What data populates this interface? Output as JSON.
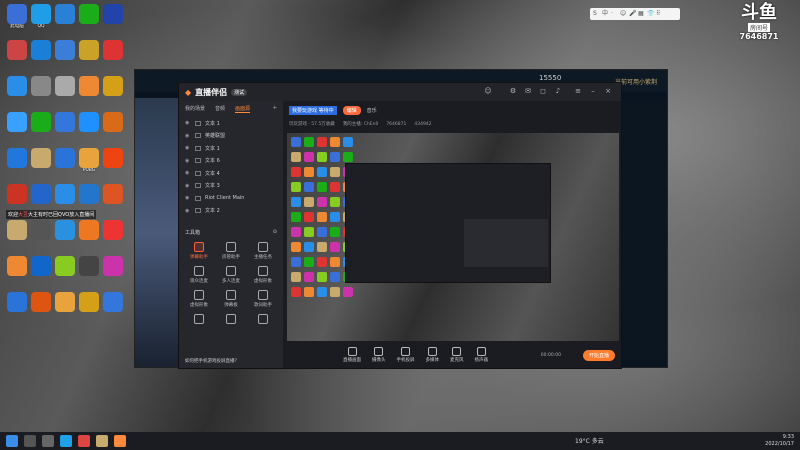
{
  "desktop": {
    "icons": [
      {
        "label": "此电脑",
        "color": "#3a6fd8"
      },
      {
        "label": "QQ",
        "color": "#1e9ee8"
      },
      {
        "label": "",
        "color": "#2a7fd6"
      },
      {
        "label": "",
        "color": "#1aad19"
      },
      {
        "label": "",
        "color": "#2244aa"
      },
      {
        "label": "",
        "color": "#c44"
      },
      {
        "label": "",
        "color": "#1a7fd6"
      },
      {
        "label": "",
        "color": "#3b7ed8"
      },
      {
        "label": "",
        "color": "#c9a227"
      },
      {
        "label": "",
        "color": "#d33"
      },
      {
        "label": "",
        "color": "#2a8de8"
      },
      {
        "label": "",
        "color": "#888"
      },
      {
        "label": "",
        "color": "#aaa"
      },
      {
        "label": "",
        "color": "#ee8833"
      },
      {
        "label": "",
        "color": "#d4a017"
      },
      {
        "label": "",
        "color": "#3aa0ff"
      },
      {
        "label": "",
        "color": "#1aad19"
      },
      {
        "label": "",
        "color": "#3377dd"
      },
      {
        "label": "",
        "color": "#1e90ff"
      },
      {
        "label": "",
        "color": "#d86a1a"
      },
      {
        "label": "",
        "color": "#2277dd"
      },
      {
        "label": "",
        "color": "#c8aa6e"
      },
      {
        "label": "",
        "color": "#2a73d8"
      },
      {
        "label": "PUBG",
        "color": "#e8a33d"
      },
      {
        "label": "",
        "color": "#ee4411"
      },
      {
        "label": "",
        "color": "#cc3322"
      },
      {
        "label": "",
        "color": "#2266cc"
      },
      {
        "label": "",
        "color": "#2a8de8"
      },
      {
        "label": "",
        "color": "#2277cc"
      },
      {
        "label": "",
        "color": "#dd5522"
      },
      {
        "label": "",
        "color": "#c8aa6e"
      },
      {
        "label": "",
        "color": "#555"
      },
      {
        "label": "",
        "color": "#2a90e0"
      },
      {
        "label": "",
        "color": "#ee7722"
      },
      {
        "label": "",
        "color": "#ee3333"
      },
      {
        "label": "",
        "color": "#ee8833"
      },
      {
        "label": "",
        "color": "#1166cc"
      },
      {
        "label": "",
        "color": "#88cc22"
      },
      {
        "label": "",
        "color": "#444"
      },
      {
        "label": "",
        "color": "#cc33aa"
      },
      {
        "label": "",
        "color": "#2a73d8"
      },
      {
        "label": "",
        "color": "#dd5511"
      },
      {
        "label": "",
        "color": "#e8a33d"
      },
      {
        "label": "",
        "color": "#d4a017"
      },
      {
        "label": "",
        "color": "#3377dd"
      }
    ],
    "notice": {
      "prefix": "欢迎",
      "highlight": "大豆",
      "suffix": "大主有时已回QVO放入直播间"
    }
  },
  "topbar_icons": [
    "S",
    "中",
    "·",
    "☺",
    "🎤",
    "▦",
    "👕",
    "⠿"
  ],
  "watermark": {
    "logo": "斗鱼",
    "room_label": "房间号",
    "room_id": "7646871"
  },
  "lol_client": {
    "coins": "15550",
    "shop_label": "当前可用小紫荆"
  },
  "app": {
    "brand": "直播伴侣",
    "version": "测试",
    "tabs": [
      {
        "label": "我的场景"
      },
      {
        "label": "音频"
      },
      {
        "label": "画面源",
        "active": true
      }
    ],
    "sources": [
      {
        "label": "文本 1"
      },
      {
        "label": "英雄联盟"
      },
      {
        "label": "文本 1"
      },
      {
        "label": "文本 6"
      },
      {
        "label": "文本 4"
      },
      {
        "label": "文本 3"
      },
      {
        "label": "Riot Client Main"
      },
      {
        "label": "文本 2"
      }
    ],
    "toolbox_label": "工具箱",
    "tools": [
      {
        "label": "弹幕助手",
        "hot": true
      },
      {
        "label": "房管助手"
      },
      {
        "label": "主播任务"
      },
      {
        "label": "观众连麦"
      },
      {
        "label": "多人连麦"
      },
      {
        "label": "虚拟形象"
      },
      {
        "label": "虚拟形象"
      },
      {
        "label": "弹幕板"
      },
      {
        "label": "歌词助手"
      },
      {
        "label": ""
      },
      {
        "label": ""
      },
      {
        "label": ""
      }
    ],
    "banner": "如何把手机游戏投屏直播？",
    "room_title": "我要玩游戏 等待中",
    "edit_label": "编辑",
    "category": "音乐",
    "sub": [
      "玩玩游戏 · 57.5万收藏",
      "我的主播: ChEn0",
      "7646871",
      "434942"
    ],
    "bottom_buttons": [
      {
        "label": "直播画面"
      },
      {
        "label": "摄像头"
      },
      {
        "label": "手机投屏"
      },
      {
        "label": "多媒体"
      },
      {
        "label": "麦克风"
      },
      {
        "label": "扬声器"
      }
    ],
    "golive_label": "开始直播",
    "timer": "00:00:00"
  },
  "taskbar": {
    "weather": "19°C 多云",
    "time": "9:33",
    "date": "2022/10/17"
  }
}
